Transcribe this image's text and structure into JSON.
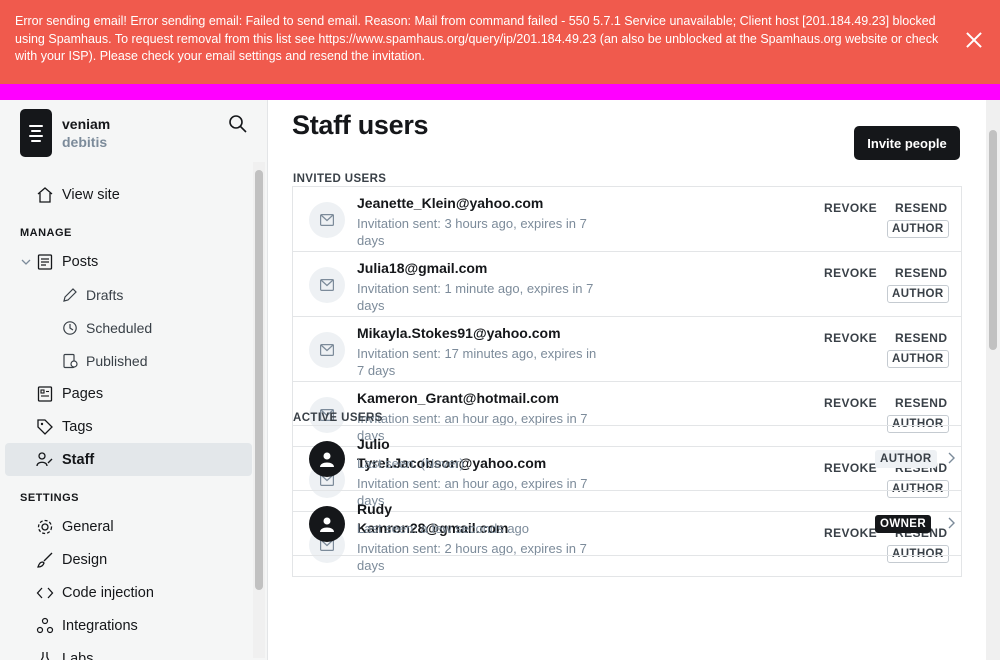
{
  "alert": {
    "message": "Error sending email! Error sending email: Failed to send email. Reason: Mail from command failed - 550 5.7.1 Service unavailable; Client host [201.184.49.23] blocked using Spamhaus. To request removal from this list see https://www.spamhaus.org/query/ip/201.184.49.23 (an also be unblocked at the Spamhaus.org website or check with your ISP). Please check your email settings and resend the invitation.",
    "close_label": "Close"
  },
  "sidebar": {
    "brand_name": "veniam",
    "brand_user": "debitis",
    "view_site": "View site",
    "manage_heading": "MANAGE",
    "settings_heading": "SETTINGS",
    "items": {
      "posts": "Posts",
      "drafts": "Drafts",
      "scheduled": "Scheduled",
      "published": "Published",
      "pages": "Pages",
      "tags": "Tags",
      "staff": "Staff",
      "general": "General",
      "design": "Design",
      "code_injection": "Code injection",
      "integrations": "Integrations",
      "labs": "Labs"
    }
  },
  "main": {
    "title": "Staff users",
    "invite_button": "Invite people",
    "invited_label": "INVITED USERS",
    "active_label": "ACTIVE USERS",
    "revoke": "REVOKE",
    "resend": "RESEND",
    "invited": [
      {
        "email": "Jeanette_Klein@yahoo.com",
        "meta": "Invitation sent: 3 hours ago, expires in 7 days",
        "role": "AUTHOR"
      },
      {
        "email": "Julia18@gmail.com",
        "meta": "Invitation sent: 1 minute ago, expires in 7 days",
        "role": "AUTHOR"
      },
      {
        "email": "Mikayla.Stokes91@yahoo.com",
        "meta": "Invitation sent: 17 minutes ago, expires in 7 days",
        "role": "AUTHOR"
      },
      {
        "email": "Kameron_Grant@hotmail.com",
        "meta": "Invitation sent: an hour ago, expires in 7 days",
        "role": "AUTHOR"
      },
      {
        "email": "Tyrel.Jacobson@yahoo.com",
        "meta": "Invitation sent: an hour ago, expires in 7 days",
        "role": "AUTHOR"
      },
      {
        "email": "Kamron28@gmail.com",
        "meta": "Invitation sent: 2 hours ago, expires in 7 days",
        "role": "AUTHOR"
      }
    ],
    "active": [
      {
        "name": "Julio",
        "seen": "Last seen: (Never)",
        "role": "AUTHOR"
      },
      {
        "name": "Rudy",
        "seen": "Last seen: a few seconds ago",
        "role": "OWNER"
      }
    ]
  }
}
